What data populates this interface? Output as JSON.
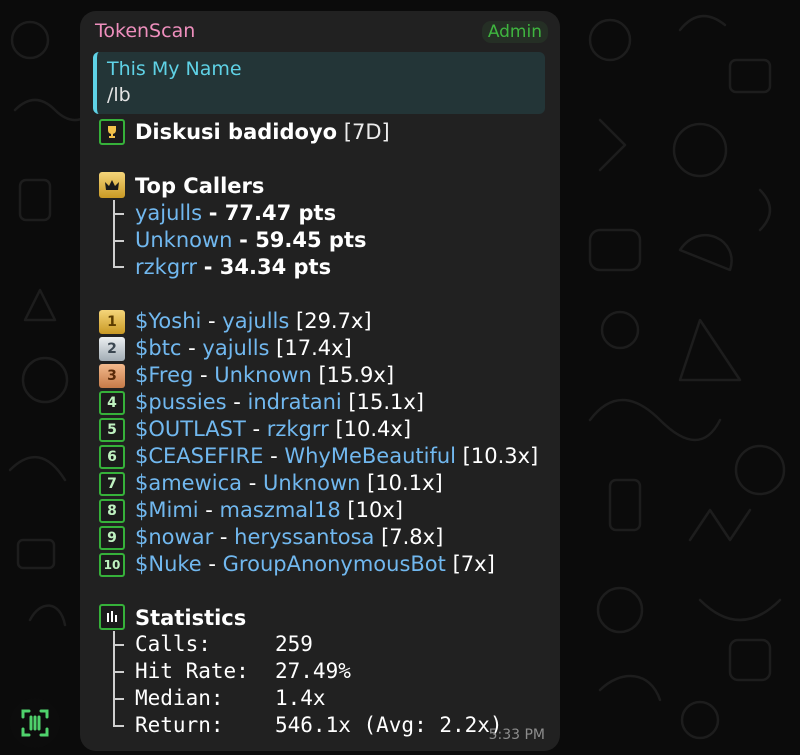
{
  "colors": {
    "background": "#0b0b0b",
    "bubble": "#212121",
    "link": "#71b8ef",
    "sender": "#ee8fbd",
    "admin": "#3fb53f",
    "reply_accent": "#5fd2e6"
  },
  "message": {
    "sender": "TokenScan",
    "badge": "Admin",
    "time": "5:33 PM",
    "reply": {
      "name": "This My Name",
      "text": "/lb"
    },
    "title": {
      "icon": "trophy-icon",
      "name": "Diskusi badidoyo",
      "period": "[7D]"
    },
    "top_callers": {
      "icon": "crown-icon",
      "heading": "Top Callers",
      "items": [
        {
          "name": "yajulls",
          "score": "- 77.47 pts"
        },
        {
          "name": "Unknown",
          "score": "- 59.45 pts"
        },
        {
          "name": "rzkgrr",
          "score": "- 34.34 pts"
        }
      ]
    },
    "leaderboard": [
      {
        "rank": "1",
        "token": "$Yoshi",
        "sep": " - ",
        "caller": "yajulls",
        "mult": " [29.7x]"
      },
      {
        "rank": "2",
        "token": "$btc",
        "sep": " - ",
        "caller": "yajulls",
        "mult": " [17.4x]"
      },
      {
        "rank": "3",
        "token": "$Freg",
        "sep": " - ",
        "caller": "Unknown",
        "mult": " [15.9x]"
      },
      {
        "rank": "4",
        "token": "$pussies",
        "sep": " - ",
        "caller": "indratani",
        "mult": " [15.1x]"
      },
      {
        "rank": "5",
        "token": "$OUTLAST",
        "sep": " - ",
        "caller": "rzkgrr",
        "mult": " [10.4x]"
      },
      {
        "rank": "6",
        "token": "$CEASEFIRE",
        "sep": " - ",
        "caller": "WhyMeBeautiful",
        "mult": " [10.3x]"
      },
      {
        "rank": "7",
        "token": "$amewica",
        "sep": " - ",
        "caller": "Unknown",
        "mult": " [10.1x]"
      },
      {
        "rank": "8",
        "token": "$Mimi",
        "sep": " - ",
        "caller": "maszmal18",
        "mult": " [10x]"
      },
      {
        "rank": "9",
        "token": "$nowar",
        "sep": " - ",
        "caller": "heryssantosa",
        "mult": " [7.8x]"
      },
      {
        "rank": "10",
        "token": "$Nuke",
        "sep": " - ",
        "caller": "GroupAnonymousBot",
        "mult": " [7x]"
      }
    ],
    "statistics": {
      "icon": "bar-chart-icon",
      "heading": "Statistics",
      "rows": [
        {
          "label": "Calls:",
          "value": "259"
        },
        {
          "label": "Hit Rate:",
          "value": "27.49%"
        },
        {
          "label": "Median:",
          "value": "1.4x"
        },
        {
          "label": "Return:",
          "value": "546.1x (Avg: 2.2x)"
        }
      ]
    }
  },
  "avatar": {
    "icon": "scan-icon"
  }
}
